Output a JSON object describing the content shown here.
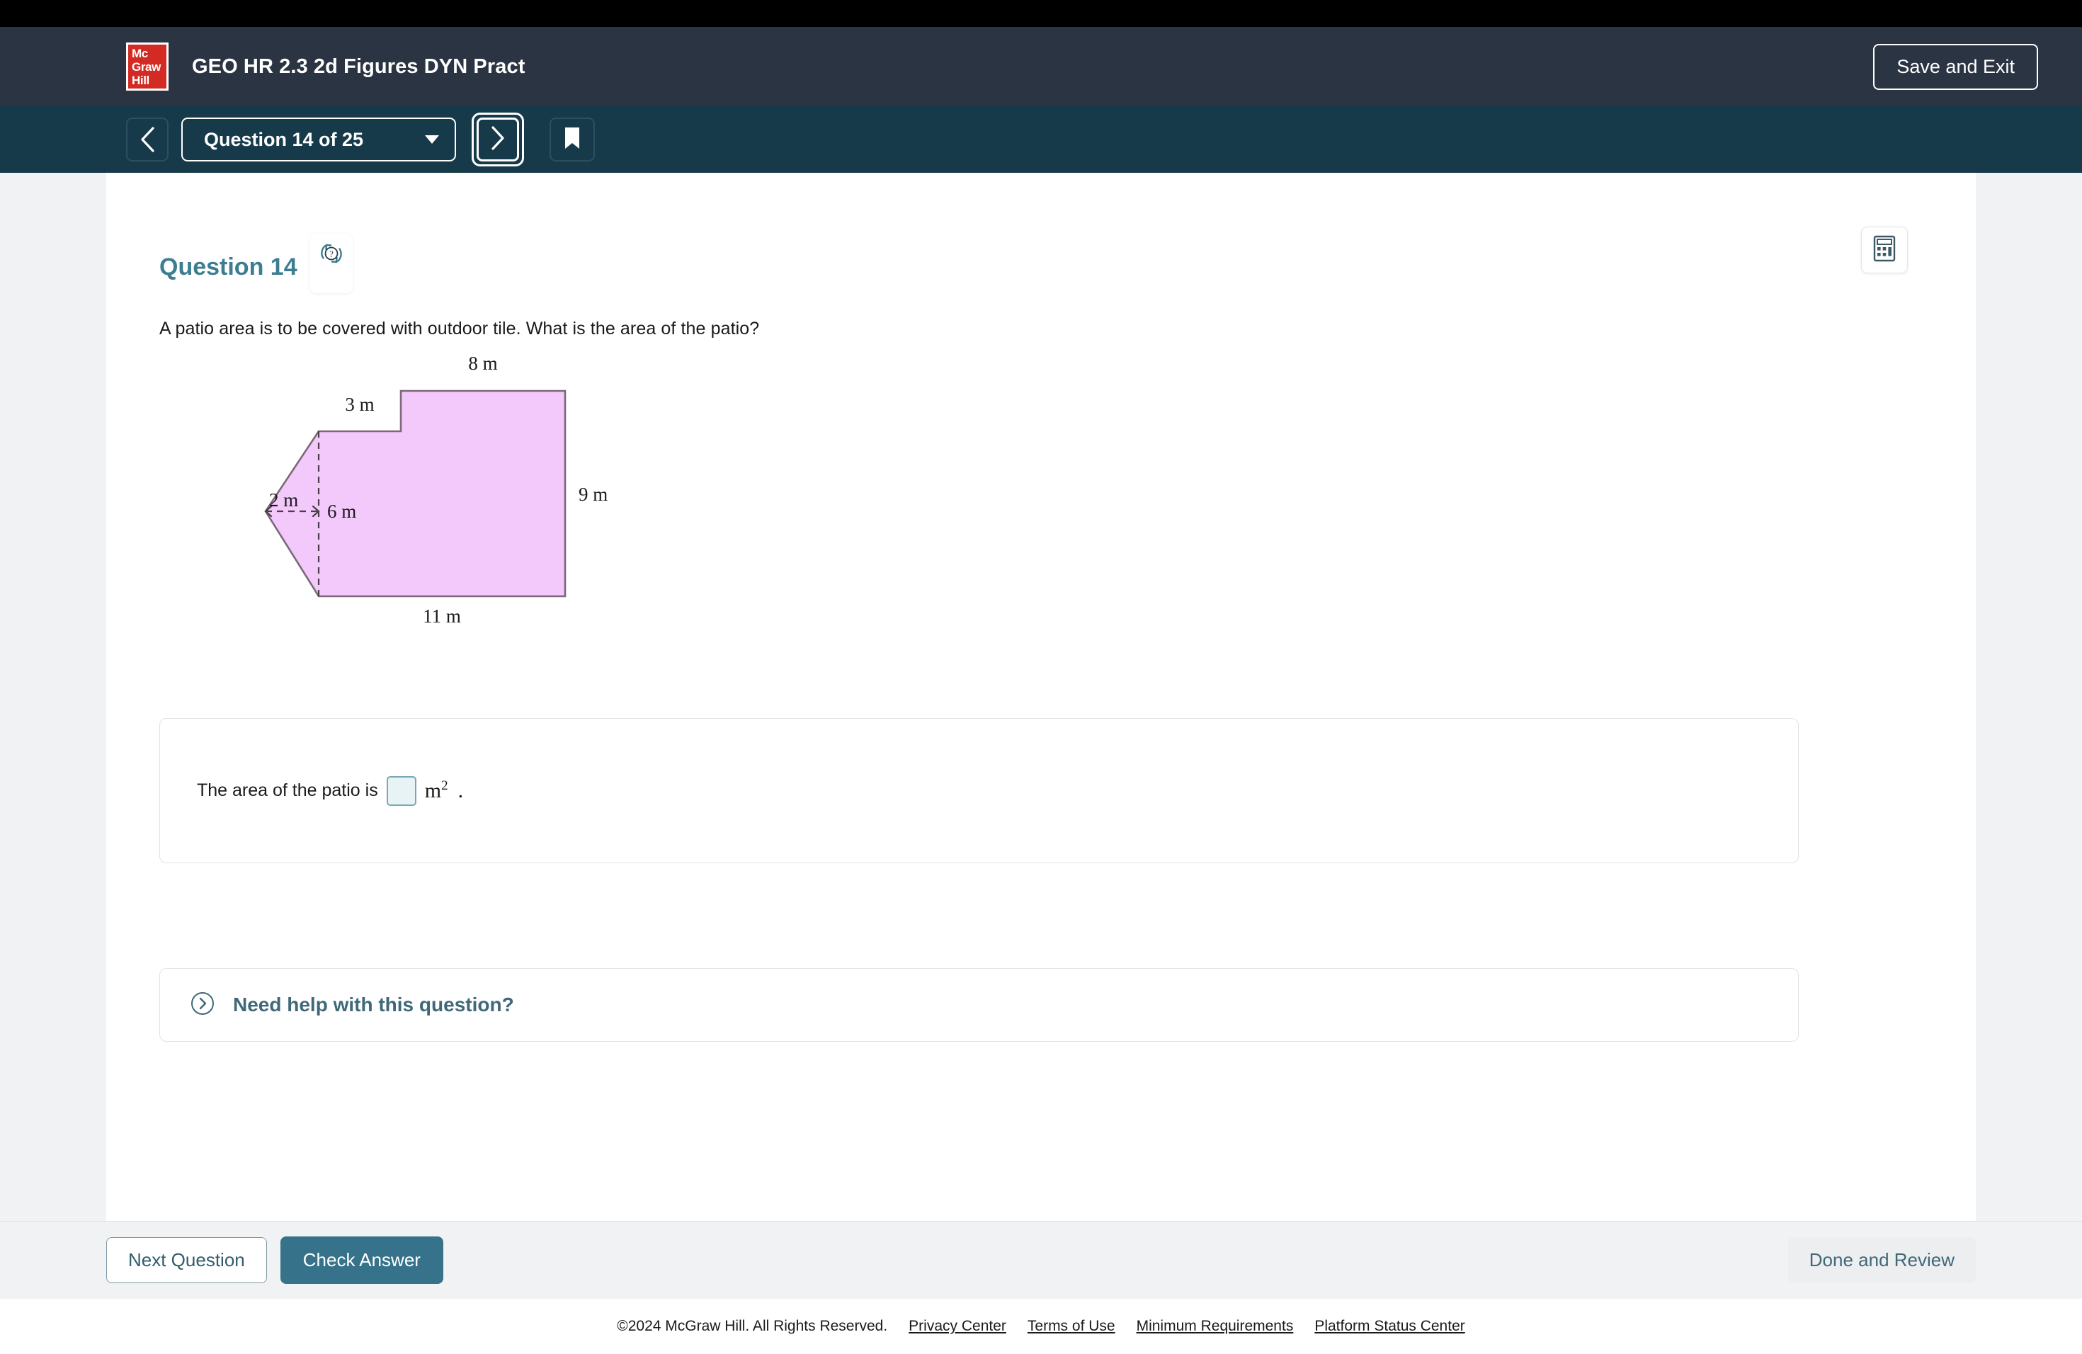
{
  "header": {
    "logo_text": [
      "Mc",
      "Graw",
      "Hill"
    ],
    "logo_icon": "mcgraw-hill-logo",
    "title": "GEO HR 2.3 2d Figures DYN Pract",
    "save_exit_label": "Save and Exit"
  },
  "nav": {
    "prev_icon": "chevron-left-icon",
    "question_selector_label": "Question 14 of 25",
    "dropdown_icon": "chevron-down-icon",
    "next_icon": "chevron-right-icon",
    "bookmark_icon": "bookmark-icon"
  },
  "question": {
    "heading": "Question 14",
    "refresh_icon": "refresh-question-icon",
    "calculator_icon": "calculator-icon",
    "prompt": "A patio area is to be covered with outdoor tile. What is the area of the patio?"
  },
  "figure": {
    "name": "patio-composite-polygon",
    "fill_color": "#f3c8fb",
    "stroke_color": "#7b6878",
    "labels": {
      "top": "8 m",
      "upper_left": "3 m",
      "triangle_height": "2 m",
      "triangle_base": "6 m",
      "right": "9 m",
      "bottom": "11 m"
    }
  },
  "answer": {
    "text_before": "The area of the patio is",
    "input_value": "",
    "unit": "m",
    "unit_exponent": "2",
    "period": "."
  },
  "help": {
    "expand_icon": "chevron-right-circle-icon",
    "label": "Need help with this question?"
  },
  "footer": {
    "next_question_label": "Next Question",
    "check_answer_label": "Check Answer",
    "done_review_label": "Done and Review",
    "copyright": "©2024 McGraw Hill. All Rights Reserved.",
    "links": [
      "Privacy Center",
      "Terms of Use",
      "Minimum Requirements",
      "Platform Status Center"
    ]
  }
}
